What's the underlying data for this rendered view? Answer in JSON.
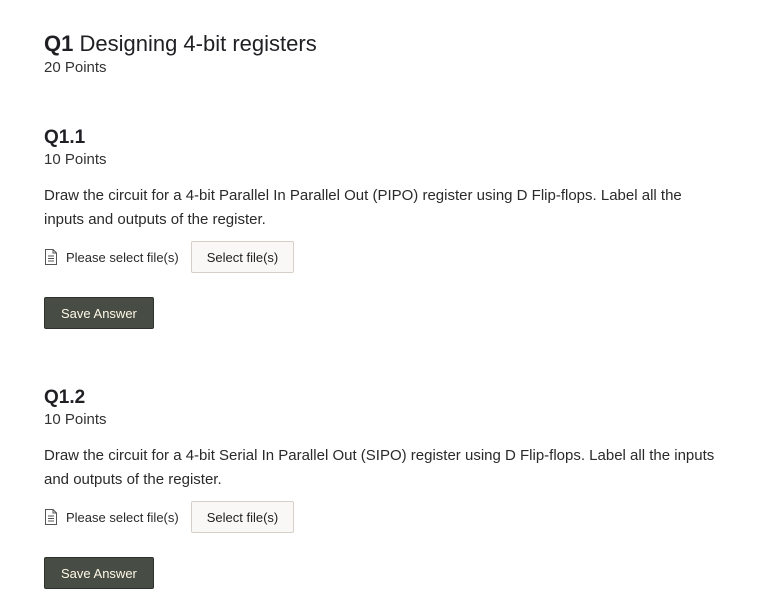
{
  "question": {
    "number": "Q1",
    "title": "Designing 4-bit registers",
    "points": "20 Points"
  },
  "subquestions": [
    {
      "number": "Q1.1",
      "points": "10 Points",
      "prompt": "Draw the circuit for a 4-bit Parallel In Parallel Out (PIPO) register using D Flip-flops. Label all the inputs and outputs of the register.",
      "file_status": "Please select file(s)",
      "select_label": "Select file(s)",
      "save_label": "Save Answer"
    },
    {
      "number": "Q1.2",
      "points": "10 Points",
      "prompt": "Draw the circuit for a 4-bit Serial In Parallel Out (SIPO) register using D Flip-flops. Label all the inputs and outputs of the register.",
      "file_status": "Please select file(s)",
      "select_label": "Select file(s)",
      "save_label": "Save Answer"
    }
  ],
  "colors": {
    "save_button_bg": "#474c45",
    "save_button_text": "#fff9e6",
    "select_button_bg": "#faf8f6",
    "select_button_border": "#d6cfc7"
  },
  "icons": {
    "file": "file-document-icon"
  }
}
